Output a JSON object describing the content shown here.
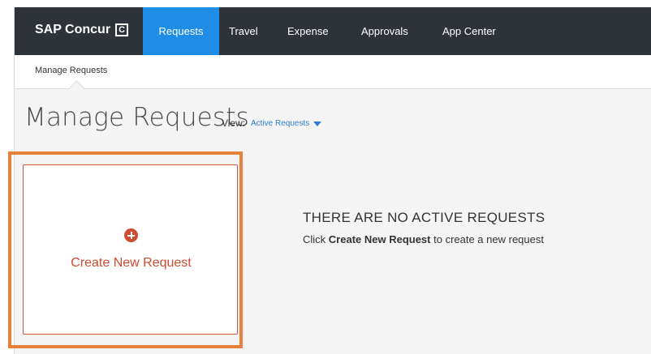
{
  "topnav": {
    "brand": "SAP Concur",
    "brand_mark": "C",
    "tabs": [
      {
        "label": "Requests",
        "active": true
      },
      {
        "label": "Travel",
        "active": false
      },
      {
        "label": "Expense",
        "active": false
      },
      {
        "label": "Approvals",
        "active": false
      },
      {
        "label": "App Center",
        "active": false
      }
    ]
  },
  "subnav": {
    "items": [
      {
        "label": "Manage Requests"
      }
    ]
  },
  "page": {
    "title": "Manage Requests",
    "view_label": "View:",
    "view_value": "Active Requests"
  },
  "create_card": {
    "label": "Create New Request",
    "icon": "plus-circle-icon"
  },
  "empty_state": {
    "title": "THERE ARE NO ACTIVE REQUESTS",
    "text_prefix": "Click ",
    "text_bold": "Create New Request",
    "text_suffix": " to create a new request"
  },
  "colors": {
    "nav_bg": "#2e333a",
    "active_tab": "#1f8ce6",
    "accent": "#d04a2f",
    "highlight": "#e8823a",
    "link": "#2a7fd4"
  }
}
